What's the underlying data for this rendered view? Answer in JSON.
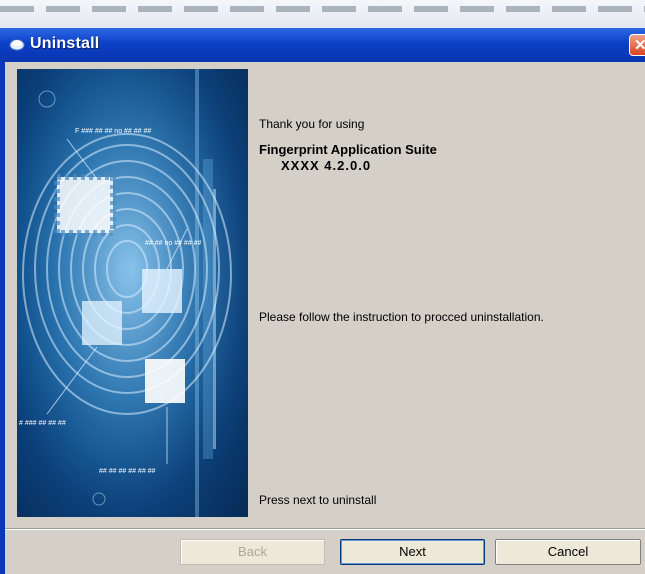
{
  "window": {
    "title": "Uninstall",
    "close_label": "✕"
  },
  "side_image": {
    "labels": [
      "F ### ## ## no ## ## ##",
      "## ## no ## ## ##",
      "# ### ## ## ##",
      "## ## ## ## ## ##"
    ]
  },
  "content": {
    "thank_you": "Thank you for using",
    "product_name": "Fingerprint Application Suite",
    "version": "XXXX  4.2.0.0",
    "instruction": "Please follow the instruction to procced uninstallation.",
    "press_next": "Press next to uninstall"
  },
  "buttons": {
    "back": "Back",
    "next": "Next",
    "cancel": "Cancel"
  },
  "colors": {
    "titlebar": "#0b3fc6",
    "dialog_bg": "#d4d0c8",
    "close_button": "#d9461e"
  }
}
